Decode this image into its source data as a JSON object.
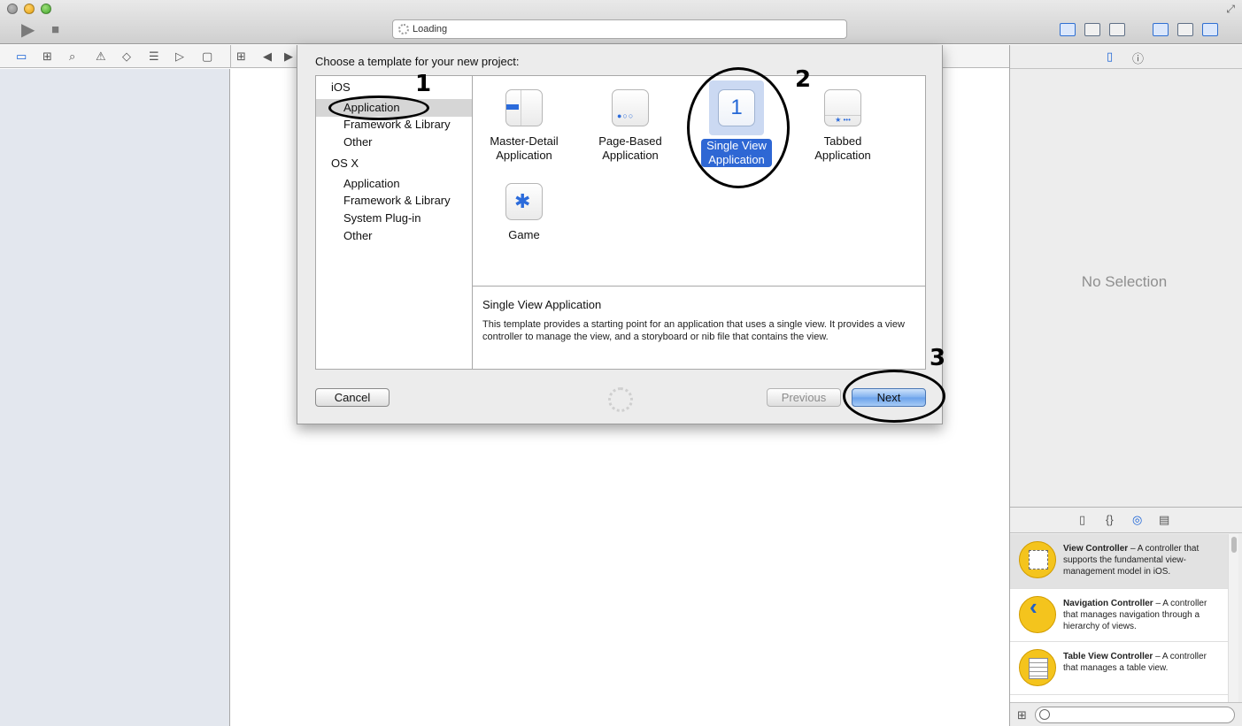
{
  "toolbar": {
    "run_icon": "play-icon",
    "stop_icon": "stop-icon",
    "activity_text": "Loading"
  },
  "navigator_icons": [
    "folder-icon",
    "hierarchy-icon",
    "search-icon",
    "warning-icon",
    "diamond-icon",
    "list-icon",
    "tag-icon",
    "speech-icon"
  ],
  "sheet": {
    "title": "Choose a template for your new project:",
    "categories": [
      {
        "label": "iOS",
        "type": "group"
      },
      {
        "label": "Application",
        "type": "sub",
        "selected": true
      },
      {
        "label": "Framework & Library",
        "type": "sub"
      },
      {
        "label": "Other",
        "type": "sub"
      },
      {
        "label": "OS X",
        "type": "group"
      },
      {
        "label": "Application",
        "type": "sub"
      },
      {
        "label": "Framework & Library",
        "type": "sub"
      },
      {
        "label": "System Plug-in",
        "type": "sub"
      },
      {
        "label": "Other",
        "type": "sub"
      }
    ],
    "templates": [
      {
        "line1": "Master-Detail",
        "line2": "Application"
      },
      {
        "line1": "Page-Based",
        "line2": "Application"
      },
      {
        "line1": "Single View",
        "line2": "Application",
        "glyph": "1",
        "selected": true
      },
      {
        "line1": "Tabbed",
        "line2": "Application"
      },
      {
        "line1": "Game",
        "line2": ""
      }
    ],
    "description": {
      "title": "Single View Application",
      "text": "This template provides a starting point for an application that uses a single view. It provides a view controller to manage the view, and a storyboard or nib file that contains the view."
    },
    "buttons": {
      "cancel": "Cancel",
      "previous": "Previous",
      "next": "Next"
    }
  },
  "utilities": {
    "no_selection": "No Selection",
    "library": [
      {
        "title": "View Controller",
        "desc": " – A controller that supports the fundamental view-management model in iOS."
      },
      {
        "title": "Navigation Controller",
        "desc": " – A controller that manages navigation through a hierarchy of views."
      },
      {
        "title": "Table View Controller",
        "desc": " – A controller that manages a table view."
      }
    ]
  },
  "annotations": [
    "1",
    "2",
    "3"
  ]
}
